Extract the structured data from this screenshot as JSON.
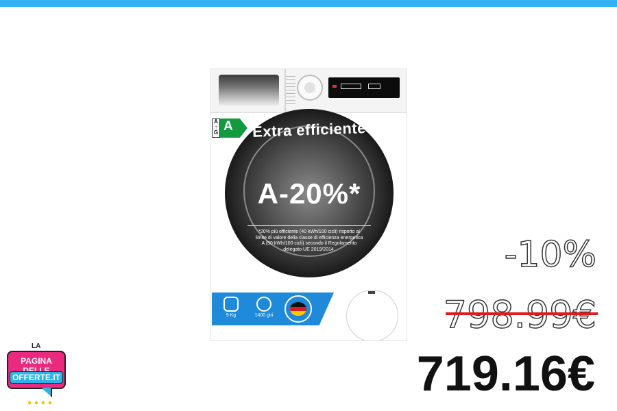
{
  "product": {
    "energy_scale": "A\n↑\nG",
    "energy_class": "A",
    "door_title": "Extra efficiente",
    "door_headline": "A-20%*",
    "door_note": "*20% più efficiente (40 kWh/100 cicli) rispetto al limite di valore della classe di efficienza energetica A (50 kWh/100 cicli) secondo il Regolamento delegato UE 2019/2014.",
    "features": [
      {
        "icon": "weight-icon",
        "label": "9 Kg"
      },
      {
        "icon": "spin-icon",
        "label": "1400 giri"
      },
      {
        "icon": "made-in-germany-badge-icon",
        "label": ""
      }
    ]
  },
  "pricing": {
    "discount": "-10%",
    "old_price": "798.99€",
    "new_price": "719.16€"
  },
  "logo": {
    "top_small": "LA",
    "line1": "PAGINA DELLE",
    "line2": "OFFERTE.IT"
  },
  "colors": {
    "top_bar": "#33b1f2",
    "energy_green": "#139a3f",
    "feature_blue": "#1e8ad9",
    "strike_red": "#e01b1b",
    "logo_pink": "#ea2a7e",
    "logo_blue": "#2fb4ea"
  }
}
